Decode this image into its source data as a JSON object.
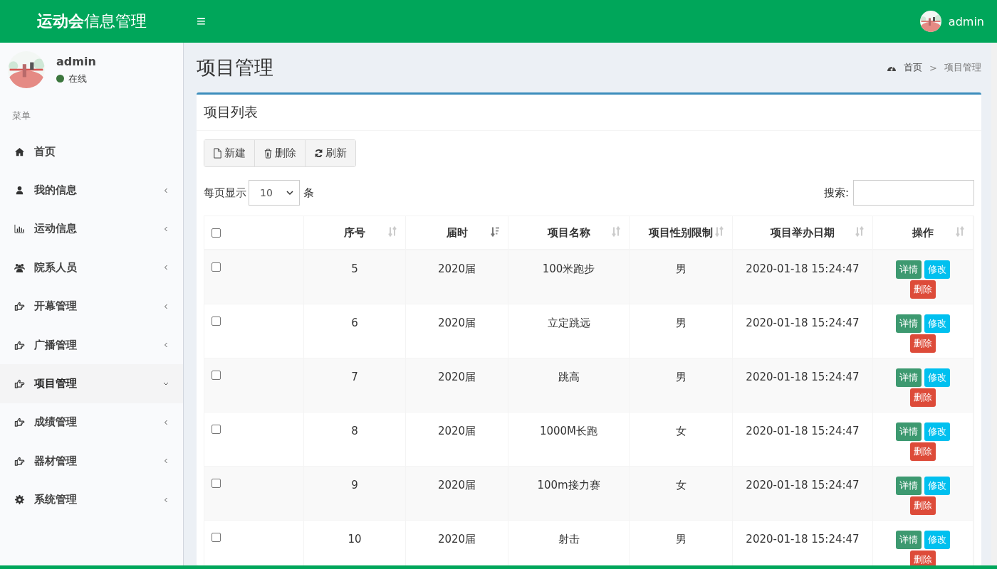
{
  "header": {
    "logo_bold": "运动会",
    "logo_rest": "信息管理",
    "menu_toggle": "≡",
    "user_name": "admin"
  },
  "sidebar": {
    "user_name": "admin",
    "status": "在线",
    "section_label": "菜单",
    "items": [
      {
        "label": "首页",
        "kind": "home",
        "selected": false
      },
      {
        "label": "我的信息",
        "kind": "user",
        "selected": false,
        "expanded": false
      },
      {
        "label": "运动信息",
        "kind": "chart",
        "selected": false,
        "expanded": false
      },
      {
        "label": "院系人员",
        "kind": "users",
        "selected": false,
        "expanded": false
      },
      {
        "label": "开幕管理",
        "kind": "hand",
        "selected": false,
        "expanded": false
      },
      {
        "label": "广播管理",
        "kind": "hand",
        "selected": false,
        "expanded": false
      },
      {
        "label": "项目管理",
        "kind": "hand",
        "selected": true,
        "expanded": true
      },
      {
        "label": "成绩管理",
        "kind": "hand",
        "selected": false,
        "expanded": false
      },
      {
        "label": "器材管理",
        "kind": "hand",
        "selected": false,
        "expanded": false
      },
      {
        "label": "系统管理",
        "kind": "gear",
        "selected": false,
        "expanded": false
      }
    ]
  },
  "page": {
    "title": "项目管理",
    "breadcrumb": [
      "首页",
      "项目管理"
    ],
    "breadcrumb_separator": ">"
  },
  "card": {
    "title": "项目列表",
    "toolbar": [
      {
        "label": "新建",
        "kind": "file"
      },
      {
        "label": "删除",
        "kind": "trash"
      },
      {
        "label": "刷新",
        "kind": "refresh"
      }
    ],
    "page_size_label": "每页显示",
    "page_size": "10",
    "page_size_unit": "条",
    "search_label": "搜索:",
    "table": {
      "select_all_checked": false,
      "columns": [
        {
          "label": "序号",
          "sorted": false
        },
        {
          "label": "届时",
          "sorted": true
        },
        {
          "label": "项目名称",
          "sorted": false
        },
        {
          "label": "项目性别限制",
          "sorted": false
        },
        {
          "label": "项目举办日期",
          "sorted": false
        },
        {
          "label": "操作",
          "sorted": false
        }
      ],
      "rows": [
        {
          "checked": false,
          "cells": [
            "5",
            "2020届",
            "100米跑步",
            "男",
            "2020-01-18 15:24:47"
          ],
          "actions": [
            {
              "label": "详情",
              "kind": "detail"
            },
            {
              "label": "修改",
              "kind": "edit"
            },
            {
              "label": "删除",
              "kind": "delete"
            }
          ]
        },
        {
          "checked": false,
          "cells": [
            "6",
            "2020届",
            "立定跳远",
            "男",
            "2020-01-18 15:24:47"
          ],
          "actions": [
            {
              "label": "详情",
              "kind": "detail"
            },
            {
              "label": "修改",
              "kind": "edit"
            },
            {
              "label": "删除",
              "kind": "delete"
            }
          ]
        },
        {
          "checked": false,
          "cells": [
            "7",
            "2020届",
            "跳高",
            "男",
            "2020-01-18 15:24:47"
          ],
          "actions": [
            {
              "label": "详情",
              "kind": "detail"
            },
            {
              "label": "修改",
              "kind": "edit"
            },
            {
              "label": "删除",
              "kind": "delete"
            }
          ]
        },
        {
          "checked": false,
          "cells": [
            "8",
            "2020届",
            "1000M长跑",
            "女",
            "2020-01-18 15:24:47"
          ],
          "actions": [
            {
              "label": "详情",
              "kind": "detail"
            },
            {
              "label": "修改",
              "kind": "edit"
            },
            {
              "label": "删除",
              "kind": "delete"
            }
          ]
        },
        {
          "checked": false,
          "cells": [
            "9",
            "2020届",
            "100m接力赛",
            "女",
            "2020-01-18 15:24:47"
          ],
          "actions": [
            {
              "label": "详情",
              "kind": "detail"
            },
            {
              "label": "修改",
              "kind": "edit"
            },
            {
              "label": "删除",
              "kind": "delete"
            }
          ]
        },
        {
          "checked": false,
          "cells": [
            "10",
            "2020届",
            "射击",
            "男",
            "2020-01-18 15:24:47"
          ],
          "actions": [
            {
              "label": "详情",
              "kind": "detail"
            },
            {
              "label": "修改",
              "kind": "edit"
            },
            {
              "label": "删除",
              "kind": "delete"
            }
          ]
        }
      ]
    }
  }
}
